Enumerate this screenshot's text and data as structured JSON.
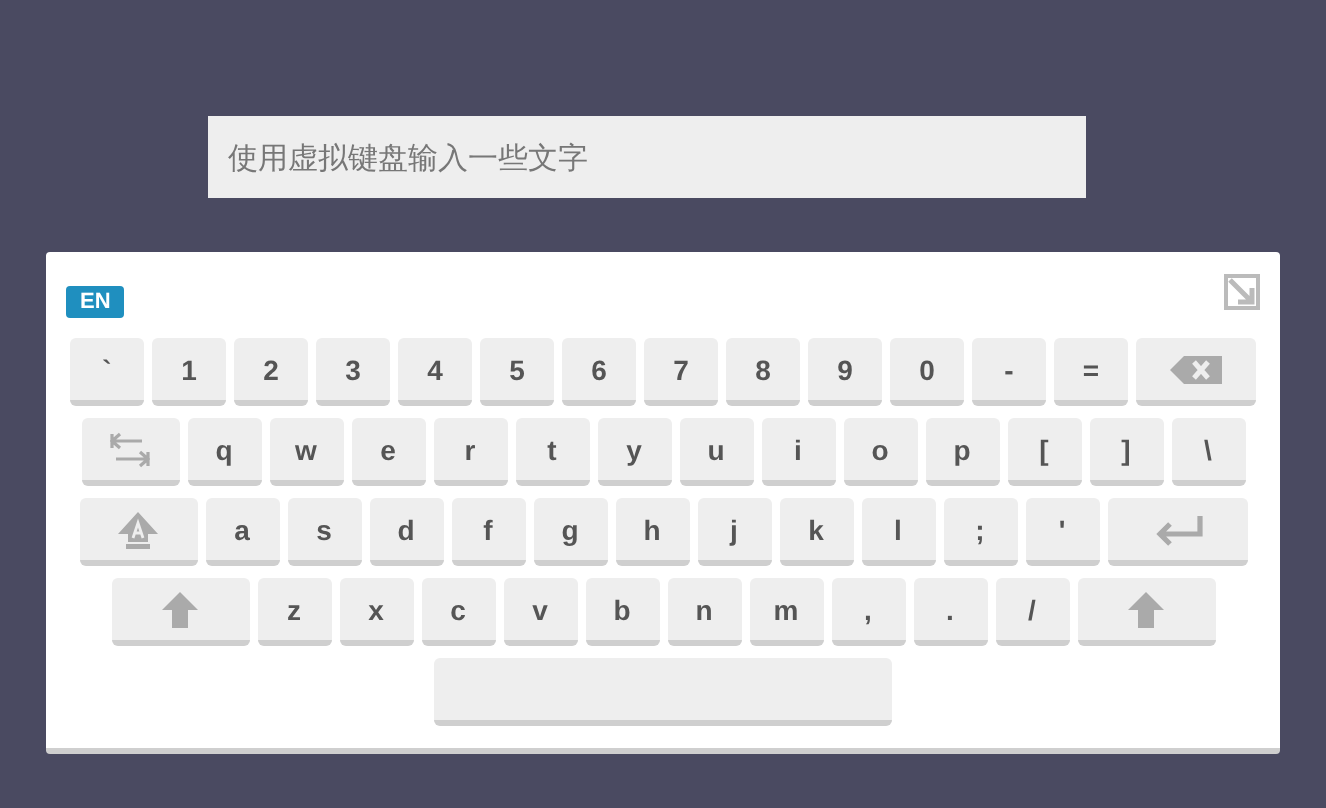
{
  "input": {
    "placeholder": "使用虚拟键盘输入一些文字"
  },
  "keyboard": {
    "language": "EN",
    "rows": [
      {
        "keys": [
          {
            "kind": "char",
            "label": "`"
          },
          {
            "kind": "char",
            "label": "1"
          },
          {
            "kind": "char",
            "label": "2"
          },
          {
            "kind": "char",
            "label": "3"
          },
          {
            "kind": "char",
            "label": "4"
          },
          {
            "kind": "char",
            "label": "5"
          },
          {
            "kind": "char",
            "label": "6"
          },
          {
            "kind": "char",
            "label": "7"
          },
          {
            "kind": "char",
            "label": "8"
          },
          {
            "kind": "char",
            "label": "9"
          },
          {
            "kind": "char",
            "label": "0"
          },
          {
            "kind": "char",
            "label": "-"
          },
          {
            "kind": "char",
            "label": "="
          },
          {
            "kind": "backspace"
          }
        ]
      },
      {
        "keys": [
          {
            "kind": "tab"
          },
          {
            "kind": "char",
            "label": "q"
          },
          {
            "kind": "char",
            "label": "w"
          },
          {
            "kind": "char",
            "label": "e"
          },
          {
            "kind": "char",
            "label": "r"
          },
          {
            "kind": "char",
            "label": "t"
          },
          {
            "kind": "char",
            "label": "y"
          },
          {
            "kind": "char",
            "label": "u"
          },
          {
            "kind": "char",
            "label": "i"
          },
          {
            "kind": "char",
            "label": "o"
          },
          {
            "kind": "char",
            "label": "p"
          },
          {
            "kind": "char",
            "label": "["
          },
          {
            "kind": "char",
            "label": "]"
          },
          {
            "kind": "char",
            "label": "\\"
          }
        ]
      },
      {
        "keys": [
          {
            "kind": "caps"
          },
          {
            "kind": "char",
            "label": "a"
          },
          {
            "kind": "char",
            "label": "s"
          },
          {
            "kind": "char",
            "label": "d"
          },
          {
            "kind": "char",
            "label": "f"
          },
          {
            "kind": "char",
            "label": "g"
          },
          {
            "kind": "char",
            "label": "h"
          },
          {
            "kind": "char",
            "label": "j"
          },
          {
            "kind": "char",
            "label": "k"
          },
          {
            "kind": "char",
            "label": "l"
          },
          {
            "kind": "char",
            "label": ";"
          },
          {
            "kind": "char",
            "label": "'"
          },
          {
            "kind": "enter"
          }
        ]
      },
      {
        "keys": [
          {
            "kind": "shift"
          },
          {
            "kind": "char",
            "label": "z"
          },
          {
            "kind": "char",
            "label": "x"
          },
          {
            "kind": "char",
            "label": "c"
          },
          {
            "kind": "char",
            "label": "v"
          },
          {
            "kind": "char",
            "label": "b"
          },
          {
            "kind": "char",
            "label": "n"
          },
          {
            "kind": "char",
            "label": "m"
          },
          {
            "kind": "char",
            "label": ","
          },
          {
            "kind": "char",
            "label": "."
          },
          {
            "kind": "char",
            "label": "/"
          },
          {
            "kind": "shift"
          }
        ]
      },
      {
        "keys": [
          {
            "kind": "space"
          }
        ]
      }
    ]
  }
}
